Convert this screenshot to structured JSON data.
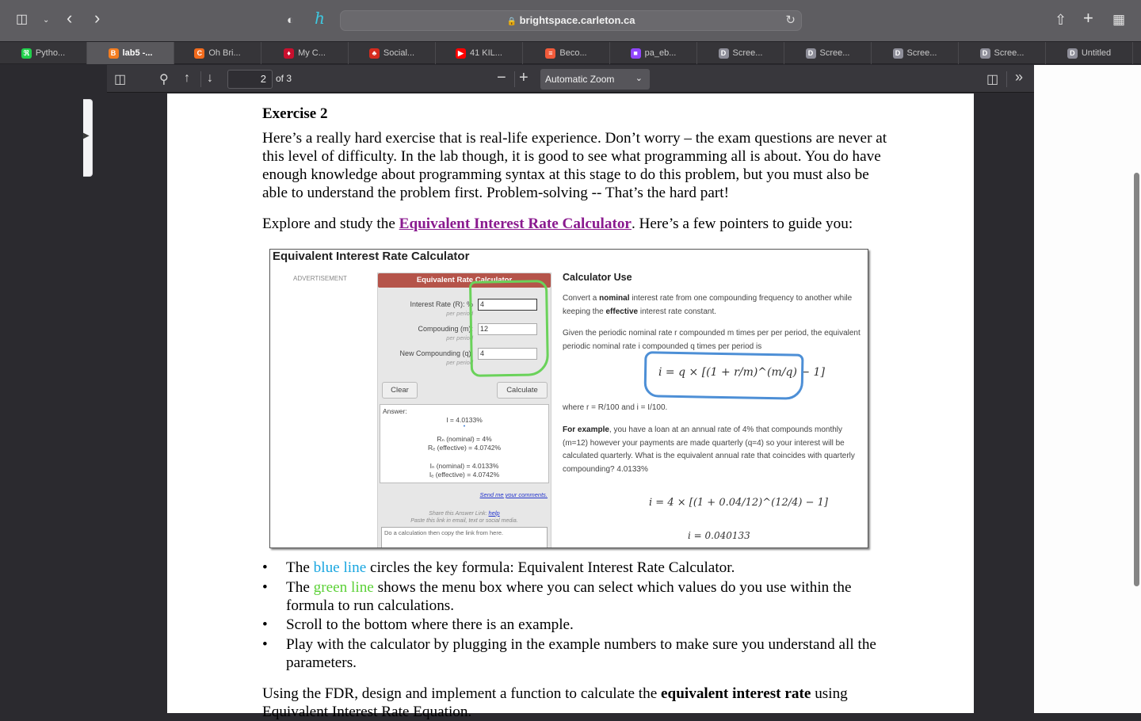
{
  "browser": {
    "url": "brightspace.carleton.ca",
    "icons": {
      "sidebar": "sidebar-icon",
      "back": "chevron-left-icon",
      "forward": "chevron-right-icon",
      "privacy": "shield-icon",
      "extension": "honey-extension-icon",
      "lock": "lock-icon",
      "reload": "reload-icon",
      "share": "share-icon",
      "new_tab": "plus-icon",
      "tab_overview": "grid-icon"
    },
    "tabs": [
      {
        "label": "Pytho...",
        "favicon": "pycharm-icon",
        "color": "#21d04c",
        "glyph": "ℜ"
      },
      {
        "label": "lab5 -...",
        "favicon": "brightspace-icon",
        "color": "#f47d20",
        "glyph": "B",
        "active": true
      },
      {
        "label": "Oh Bri...",
        "favicon": "c-icon",
        "color": "#f26b1d",
        "glyph": "C"
      },
      {
        "label": "My C...",
        "favicon": "carleton-icon",
        "color": "#c8102e",
        "glyph": "♦"
      },
      {
        "label": "Social...",
        "favicon": "canada-flag-icon",
        "color": "#d52b1e",
        "glyph": "♣"
      },
      {
        "label": "41 KIL...",
        "favicon": "youtube-icon",
        "color": "#ff0000",
        "glyph": "▶"
      },
      {
        "label": "Beco...",
        "favicon": "stack-icon",
        "color": "#f15a3a",
        "glyph": "≡"
      },
      {
        "label": "pa_eb...",
        "favicon": "twitch-icon",
        "color": "#9146ff",
        "glyph": "■"
      },
      {
        "label": "Scree...",
        "favicon": "d-icon",
        "color": "#8e8e99",
        "glyph": "D"
      },
      {
        "label": "Scree...",
        "favicon": "d-icon",
        "color": "#8e8e99",
        "glyph": "D"
      },
      {
        "label": "Scree...",
        "favicon": "d-icon",
        "color": "#8e8e99",
        "glyph": "D"
      },
      {
        "label": "Scree...",
        "favicon": "d-icon",
        "color": "#8e8e99",
        "glyph": "D"
      },
      {
        "label": "Untitled",
        "favicon": "d-icon",
        "color": "#8e8e99",
        "glyph": "D"
      }
    ]
  },
  "pdf_toolbar": {
    "page_number": "2",
    "page_count": "of 3",
    "zoom": "Automatic Zoom"
  },
  "document": {
    "heading": "Exercise 2",
    "intro": "Here’s a really hard exercise that is real-life experience. Don’t worry – the exam questions are never at this level of difficulty. In the lab though, it is good to see what programming all is about. You do have enough knowledge about programming syntax at this stage to do this problem, but you must also be able to understand the problem first. Problem-solving -- That’s the hard part!",
    "explore_prefix": "Explore and study the ",
    "explore_link": "Equivalent Interest Rate Calculator",
    "explore_suffix": ". Here’s a few pointers to guide you:",
    "bullets": [
      {
        "pre": "The ",
        "hl": "blue line",
        "post": " circles the key formula:  Equivalent Interest Rate Calculator."
      },
      {
        "pre": "The ",
        "hl": "green line",
        "post": " shows the menu box where you can select which values do you use within the formula to run calculations."
      },
      {
        "text": "Scroll to the bottom where there is an example."
      },
      {
        "text": "Play with the calculator by plugging in the example numbers to make sure you understand all the parameters."
      }
    ],
    "using_prefix": "Using the FDR, design and implement a function to calculate the ",
    "using_bold": "equivalent interest rate",
    "using_suffix": " using Equivalent Interest Rate Equation."
  },
  "screenshot": {
    "title": "Equivalent Interest Rate Calculator",
    "advertisement": "ADVERTISEMENT",
    "calc_header": "Equivalent Rate Calculator",
    "fields": [
      {
        "label": "Interest Rate (R): %",
        "sub": "per period",
        "value": "4"
      },
      {
        "label": "Compouding (m):",
        "sub": "per period",
        "value": "12"
      },
      {
        "label": "New Compounding (q):",
        "sub": "per period",
        "value": "4"
      }
    ],
    "clear": "Clear",
    "calculate": "Calculate",
    "answer_label": "Answer:",
    "answer_lines": [
      "I = 4.0133%",
      "Rₙ (nominal) = 4%",
      "Rₑ (effective) = 4.0742%",
      "Iₙ (nominal) = 4.0133%",
      "Iₑ (effective) = 4.0742%"
    ],
    "comments_link": "Send me your comments.",
    "share_line": "Share this Answer Link: ",
    "share_help": "help",
    "paste_line": "Paste this link in email, text or social media.",
    "share_box": "Do a calculation then copy the link from here.",
    "use_heading": "Calculator Use",
    "use_p1_a": "Convert a ",
    "use_p1_b": "nominal",
    "use_p1_c": " interest rate from one compounding frequency to another while keeping the ",
    "use_p1_d": "effective",
    "use_p1_e": " interest rate constant.",
    "use_p2": "Given the periodic nominal rate r compounded m times per per period, the equivalent periodic nominal rate i compounded q times per period is",
    "formula": "i = q × [(1 + r/m)^(m/q) − 1]",
    "where": "where r = R/100 and i = I/100.",
    "example_bold": "For example",
    "example_text": ", you have a loan at an annual rate of 4% that compounds monthly (m=12) however your payments are made quarterly (q=4) so your interest will be calculated quarterly.  What is the equivalent annual rate that coincides with quarterly compounding? 4.0133%",
    "example_formula": "i = 4 × [(1 + 0.04/12)^(12/4) − 1]",
    "example_result": "i = 0.040133"
  }
}
